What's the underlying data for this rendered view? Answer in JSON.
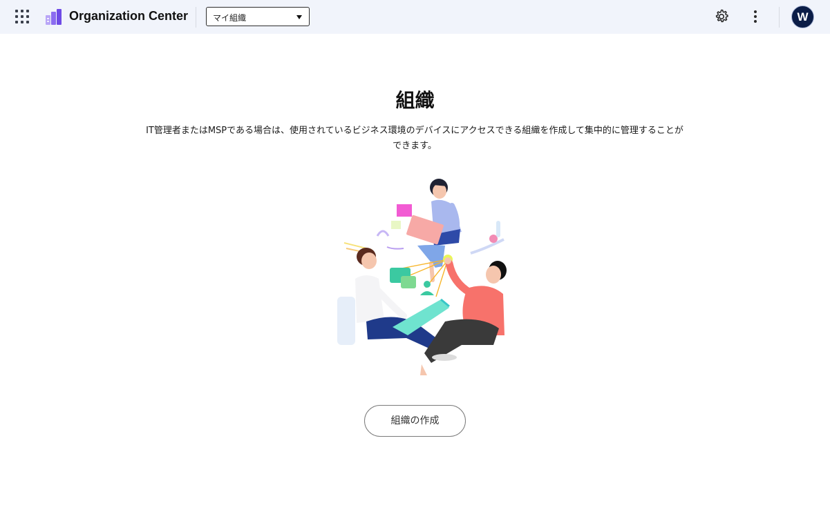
{
  "header": {
    "app_title": "Organization Center",
    "org_selector": {
      "selected": "マイ組織"
    },
    "avatar_initial": "W"
  },
  "icons": {
    "apps": "apps-grid-icon",
    "logo": "organization-center-logo",
    "dropdown": "caret-down-icon",
    "settings": "gear-icon",
    "more": "more-vertical-icon"
  },
  "main": {
    "title": "組織",
    "description": "IT管理者またはMSPである場合は、使用されているビジネス環境のデバイスにアクセスできる組織を作成して集中的に管理することができます。",
    "create_button": "組織の作成"
  },
  "colors": {
    "header_bg": "#f1f4fb",
    "logo_purple": "#8b6cf0",
    "avatar_bg": "#0b1d47"
  }
}
